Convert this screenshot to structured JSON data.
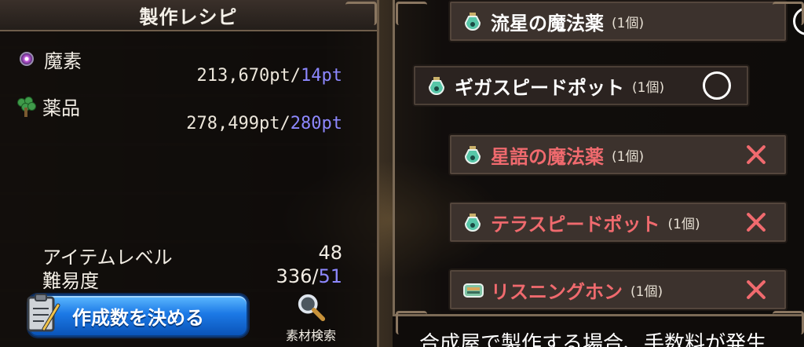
{
  "left_panel": {
    "title": "製作レシピ",
    "resources": [
      {
        "icon": "magic-orb-icon",
        "label": "魔素",
        "owned": "213,670pt",
        "cost": "14pt"
      },
      {
        "icon": "herb-icon",
        "label": "薬品",
        "owned": "278,499pt",
        "cost": "280pt"
      }
    ],
    "item_level": {
      "label": "アイテムレベル",
      "value": "48"
    },
    "difficulty": {
      "label": "難易度",
      "value": "336",
      "max": "51"
    },
    "decide_button": "作成数を決める",
    "search_button": "素材検索"
  },
  "right_panel": {
    "items": [
      {
        "name": "流星の魔法薬",
        "count": "(1個)",
        "status": "ok",
        "craftable": true
      },
      {
        "name": "ギガスピードポット",
        "count": "(1個)",
        "status": "ok",
        "craftable": true,
        "selected": true
      },
      {
        "name": "星語の魔法薬",
        "count": "(1個)",
        "status": "ng",
        "craftable": false
      },
      {
        "name": "テラスピードポット",
        "count": "(1個)",
        "status": "ng",
        "craftable": false
      },
      {
        "name": "リスニングホン",
        "count": "(1個)",
        "status": "ng",
        "craftable": false
      }
    ],
    "bottom_note": "合成屋で製作する場合、手数料が発生"
  },
  "colors": {
    "cost_blue": "#8d88ff",
    "unavailable_red": "#f06a6e",
    "button_blue": "#1c79e6"
  }
}
